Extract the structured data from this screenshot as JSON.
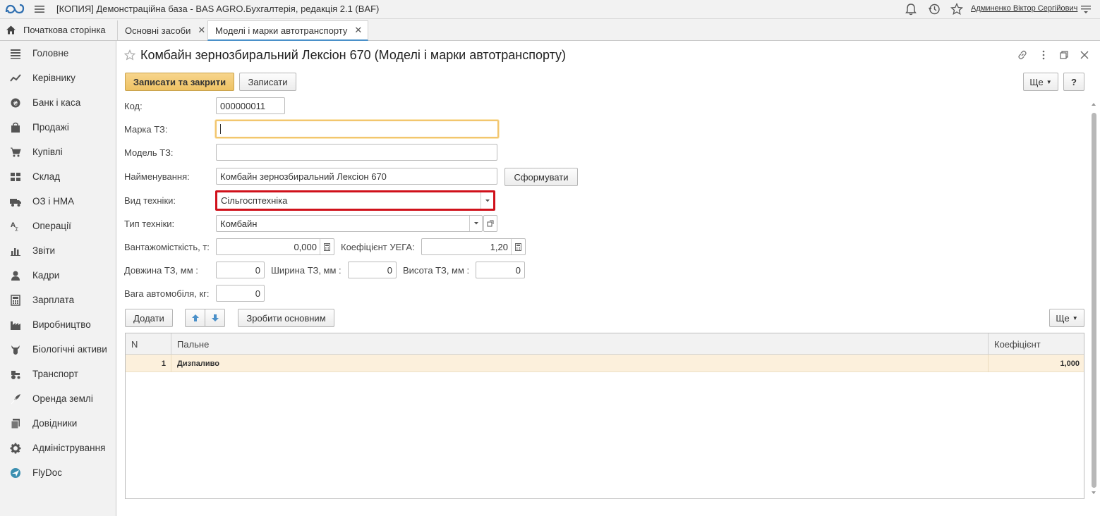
{
  "app": {
    "title": "[КОПИЯ] Демонстраційна база - BAS AGRO.Бухгалтерія, редакція 2.1  (BAF)",
    "user": "Админенко Віктор Сергійович"
  },
  "tabs": {
    "home": "Початкова сторінка",
    "items": [
      {
        "label": "Основні засоби"
      },
      {
        "label": "Моделі і марки автотранспорту"
      }
    ]
  },
  "sidebar": {
    "items": [
      {
        "label": "Головне",
        "icon": "list-icon"
      },
      {
        "label": "Керівнику",
        "icon": "trend-icon"
      },
      {
        "label": "Банк і каса",
        "icon": "coin-icon"
      },
      {
        "label": "Продажі",
        "icon": "bag-icon"
      },
      {
        "label": "Купівлі",
        "icon": "cart-icon"
      },
      {
        "label": "Склад",
        "icon": "warehouse-icon"
      },
      {
        "label": "ОЗ і НМА",
        "icon": "truck-icon"
      },
      {
        "label": "Операції",
        "icon": "operations-icon"
      },
      {
        "label": "Звіти",
        "icon": "bar-chart-icon"
      },
      {
        "label": "Кадри",
        "icon": "person-icon"
      },
      {
        "label": "Зарплата",
        "icon": "calculator-icon"
      },
      {
        "label": "Виробництво",
        "icon": "factory-icon"
      },
      {
        "label": "Біологічні активи",
        "icon": "cow-icon"
      },
      {
        "label": "Транспорт",
        "icon": "tractor-icon"
      },
      {
        "label": "Оренда землі",
        "icon": "feather-icon"
      },
      {
        "label": "Довідники",
        "icon": "books-icon"
      },
      {
        "label": "Адміністрування",
        "icon": "gear-icon"
      },
      {
        "label": "FlyDoc",
        "icon": "flydoc-icon"
      }
    ]
  },
  "form": {
    "title": "Комбайн зернозбиральний Лексіон 670 (Моделі і марки автотранспорту)",
    "buttons": {
      "save_close": "Записати та закрити",
      "save": "Записати",
      "more": "Ще",
      "help": "?",
      "generate": "Сформувати"
    },
    "fields": {
      "code_label": "Код:",
      "code_value": "000000011",
      "brand_label": "Марка ТЗ:",
      "brand_value": "",
      "model_label": "Модель ТЗ:",
      "model_value": "",
      "name_label": "Найменування:",
      "name_value": "Комбайн зернозбиральний Лексіон 670",
      "kind_label": "Вид техніки:",
      "kind_value": "Сільгосптехніка",
      "type_label": "Тип техніки:",
      "type_value": "Комбайн",
      "capacity_label": "Вантажомісткість, т:",
      "capacity_value": "0,000",
      "uega_label": "Коефіцієнт УЕГА:",
      "uega_value": "1,20",
      "length_label": "Довжина ТЗ, мм :",
      "length_value": "0",
      "width_label": "Ширина ТЗ, мм :",
      "width_value": "0",
      "height_label": "Висота ТЗ, мм :",
      "height_value": "0",
      "weight_label": "Вага автомобіля, кг:",
      "weight_value": "0"
    }
  },
  "fuel_table": {
    "toolbar": {
      "add": "Додати",
      "make_main": "Зробити основним",
      "more": "Ще"
    },
    "columns": [
      "N",
      "Пальне",
      "Коефіцієнт"
    ],
    "rows": [
      {
        "n": "1",
        "fuel": "Дизпаливо",
        "coef": "1,000"
      }
    ]
  },
  "colors": {
    "accent": "#4a90c9",
    "primary_button": "#eec264",
    "highlight": "#d0111b",
    "selected_row": "#fcf0dc"
  }
}
